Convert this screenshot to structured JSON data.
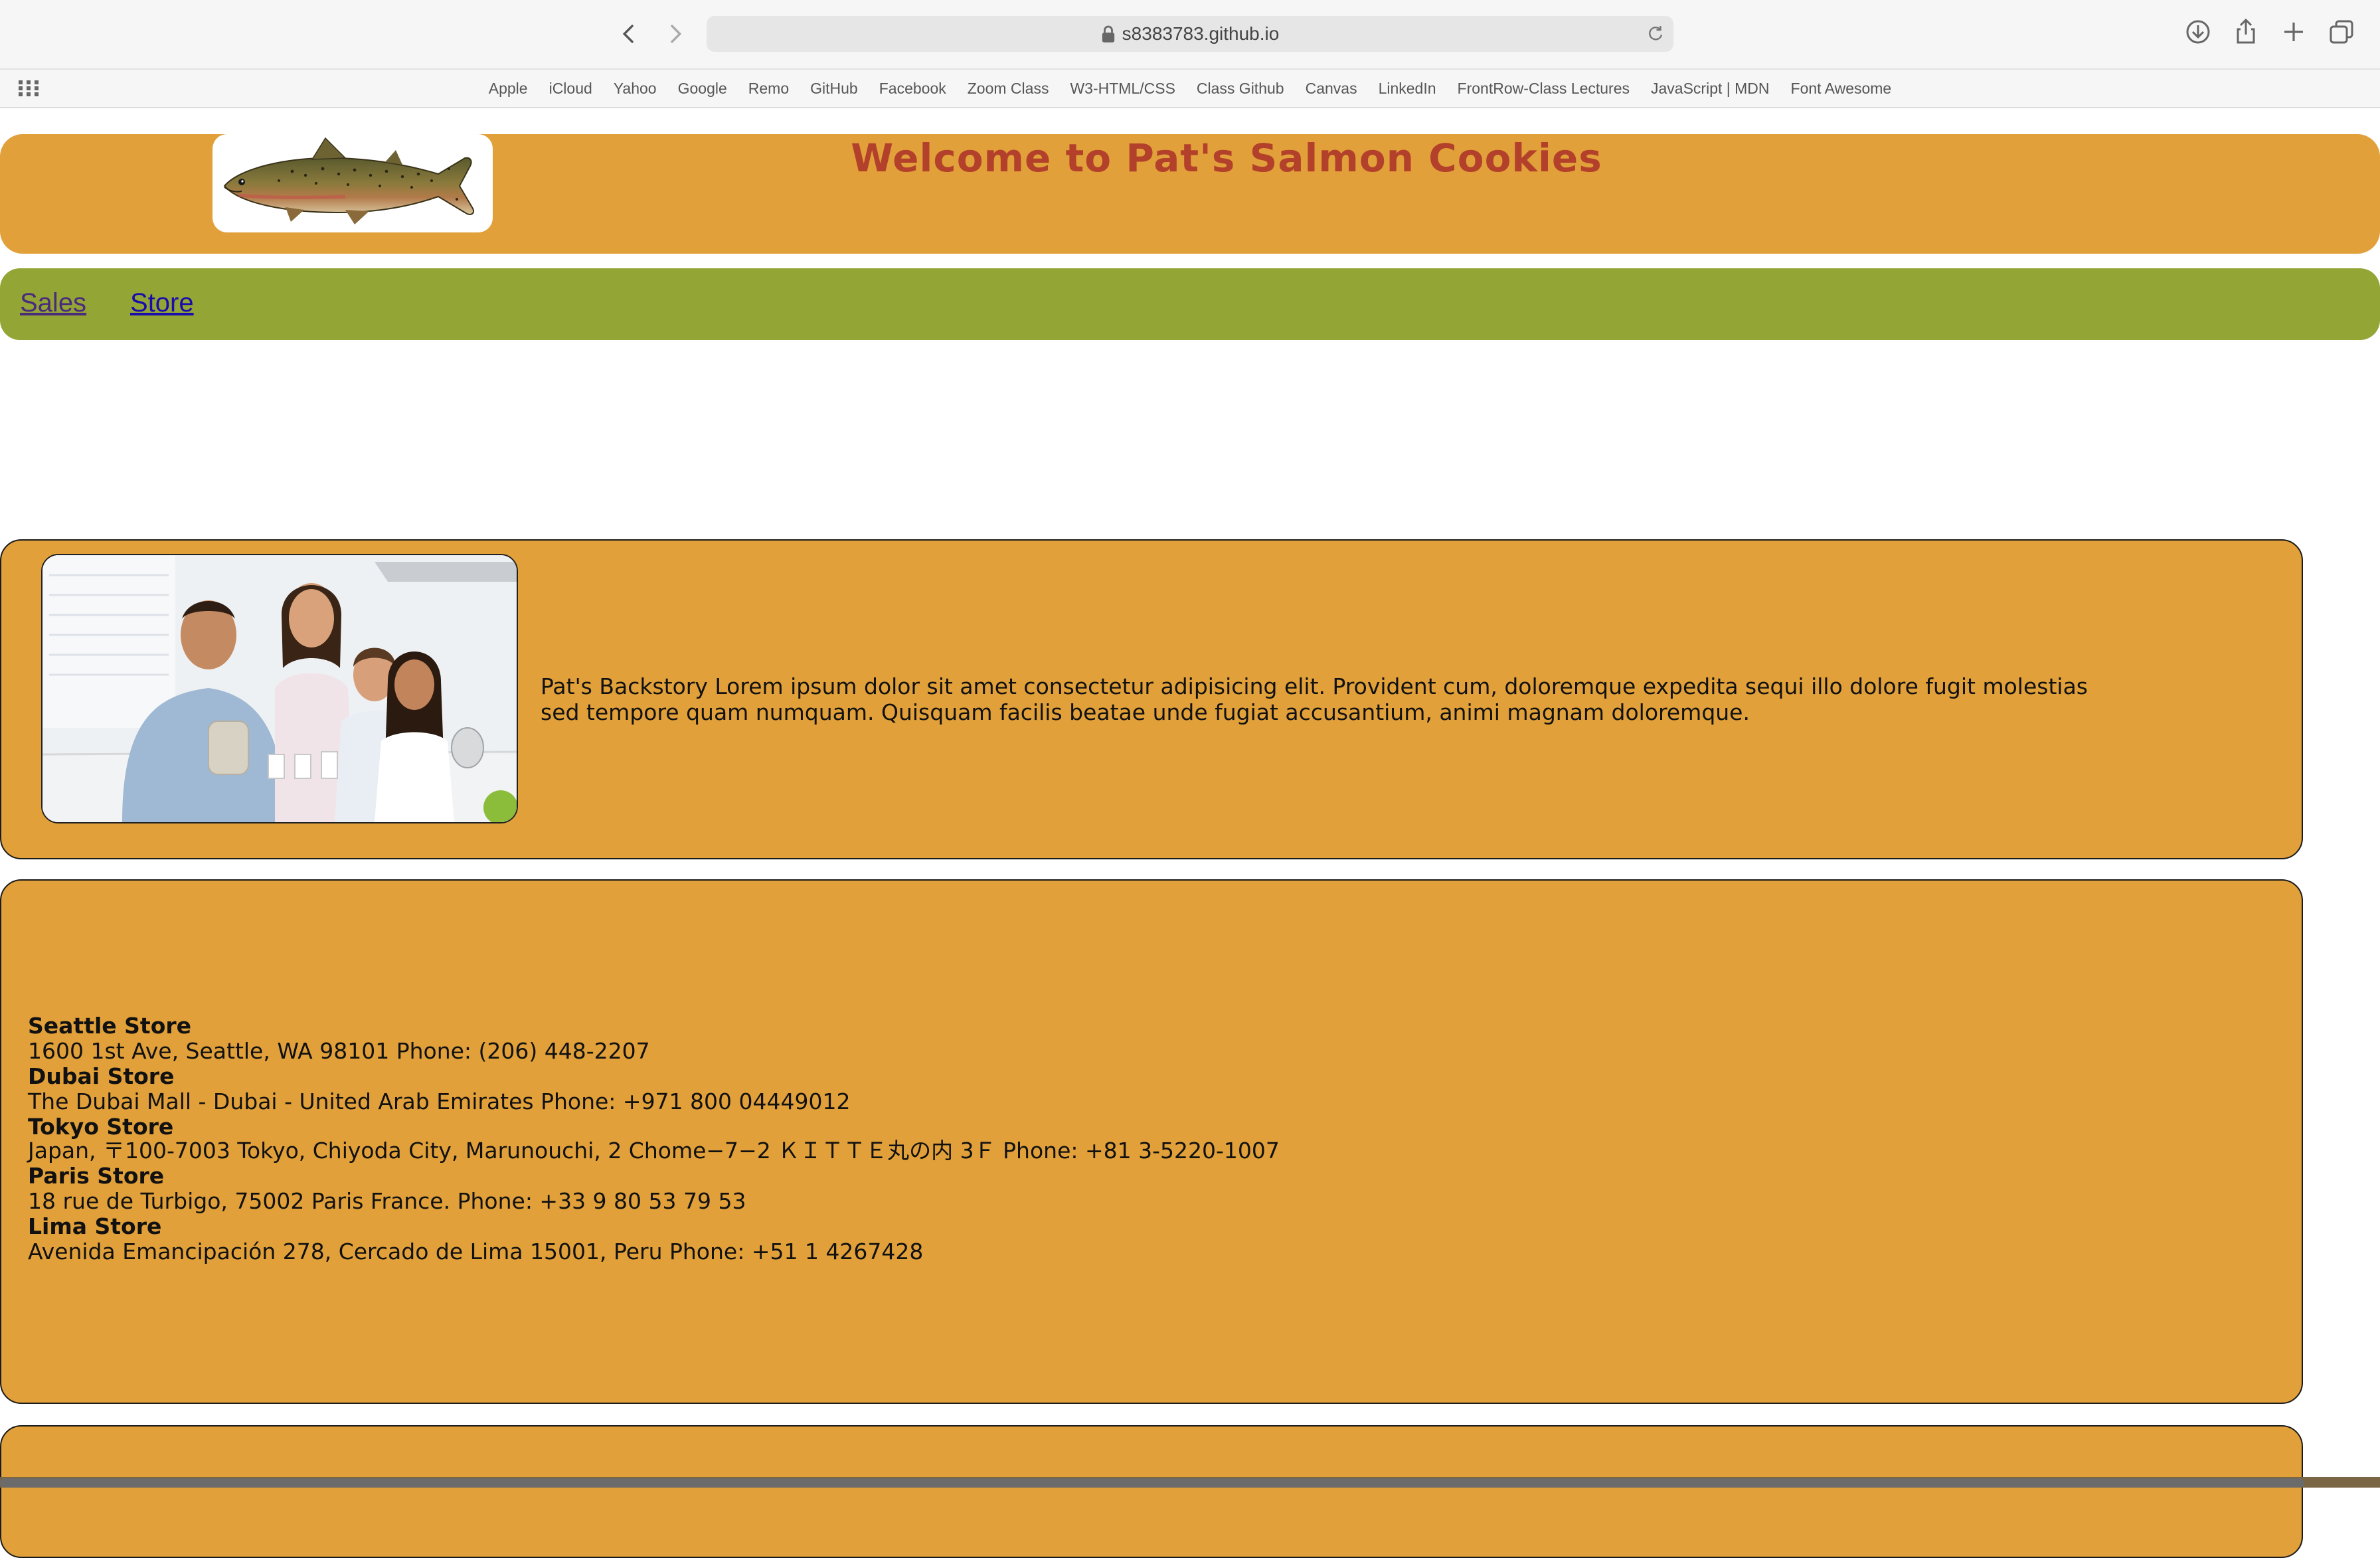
{
  "browser": {
    "url": "s8383783.github.io",
    "bookmarks": [
      "Apple",
      "iCloud",
      "Yahoo",
      "Google",
      "Remo",
      "GitHub",
      "Facebook",
      "Zoom Class",
      "W3-HTML/CSS",
      "Class Github",
      "Canvas",
      "LinkedIn",
      "FrontRow-Class Lectures",
      "JavaScript | MDN",
      "Font Awesome"
    ]
  },
  "header": {
    "title": "Welcome to Pat's Salmon Cookies"
  },
  "nav": {
    "sales": "Sales",
    "store": "Store"
  },
  "about": {
    "backstory": "Pat's Backstory Lorem ipsum dolor sit amet consectetur adipisicing elit. Provident cum, doloremque expedita sequi illo dolore fugit molestias sed tempore quam numquam. Quisquam facilis beatae unde fugiat accusantium, animi magnam doloremque."
  },
  "stores": [
    {
      "name": "Seattle Store",
      "details": "1600 1st Ave, Seattle, WA 98101 Phone: (206) 448-2207"
    },
    {
      "name": "Dubai Store",
      "details": "The Dubai Mall - Dubai - United Arab Emirates Phone: +971 800 04449012"
    },
    {
      "name": "Tokyo Store",
      "details": "Japan, 〒100-7003 Tokyo, Chiyoda City, Marunouchi, 2 Chome−7−2 ＫＩＴＴＥ丸の内 3Ｆ Phone: +81 3-5220-1007"
    },
    {
      "name": "Paris Store",
      "details": "18 rue de Turbigo, 75002 Paris France. Phone: +33 9 80 53 79 53"
    },
    {
      "name": "Lima Store",
      "details": "Avenida Emancipación 278, Cercado de Lima 15001, Peru Phone: +51 1 4267428"
    }
  ],
  "colors": {
    "header_bg": "#e1a039",
    "nav_bg": "#93a535",
    "title": "#b3402a"
  }
}
